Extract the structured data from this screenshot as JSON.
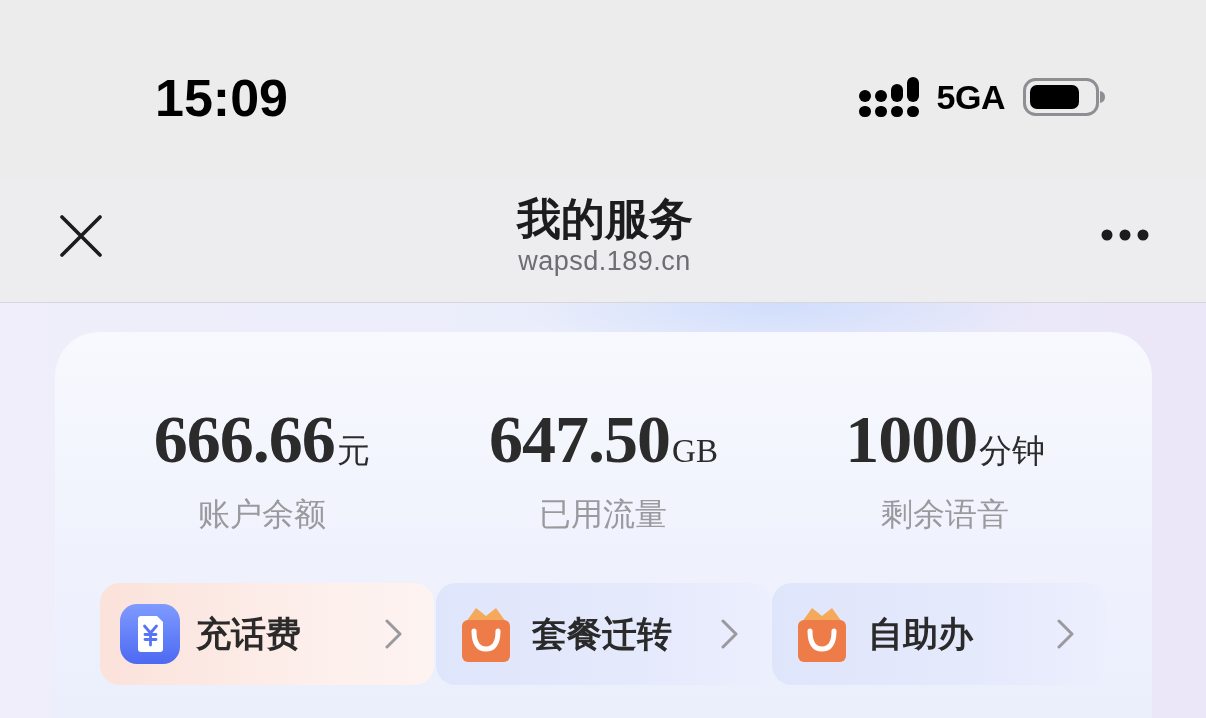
{
  "status_bar": {
    "time": "15:09",
    "network": "5GA"
  },
  "nav_bar": {
    "title": "我的服务",
    "url": "wapsd.189.cn"
  },
  "stats": [
    {
      "value": "666.66",
      "unit": "元",
      "label": "账户余额"
    },
    {
      "value": "647.50",
      "unit": "GB",
      "label": "已用流量"
    },
    {
      "value": "1000",
      "unit": "分钟",
      "label": "剩余语音"
    }
  ],
  "quick_actions": [
    {
      "label": "充话费",
      "kind": "recharge",
      "highlighted": true
    },
    {
      "label": "套餐迁转",
      "kind": "bag",
      "highlighted": false
    },
    {
      "label": "自助办",
      "kind": "bag",
      "highlighted": false
    }
  ]
}
